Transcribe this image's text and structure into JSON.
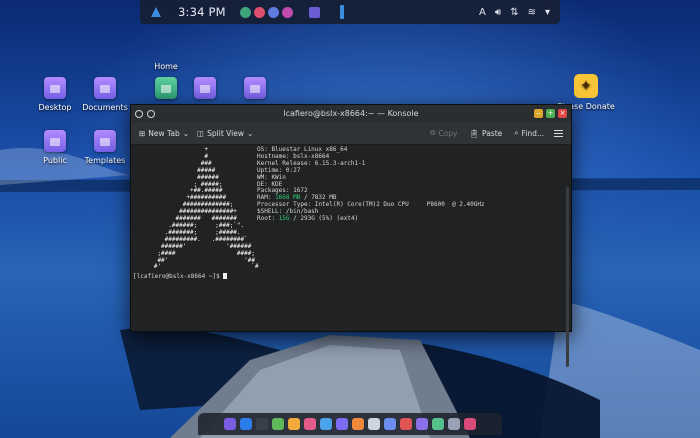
{
  "top_panel": {
    "clock": "3:34 PM",
    "app_icon_colors": [
      "#3fa37c",
      "#e0506e",
      "#5e7be0",
      "#c04cb0"
    ],
    "tray_icons": [
      "accessibility-icon",
      "volume-icon",
      "network-icon",
      "wifi-icon",
      "chevron-down-icon"
    ]
  },
  "desktop": {
    "icons": [
      {
        "label": "Desktop"
      },
      {
        "label": "Documents"
      },
      {
        "label": "Home"
      },
      {
        "label": "Public"
      },
      {
        "label": "Templates"
      },
      {
        "label": "Please Donate"
      }
    ]
  },
  "konsole": {
    "title": "lcafiero@bslx-x8664:~ — Konsole",
    "toolbar": {
      "new_tab": "New Tab",
      "split_view": "Split View",
      "copy": "Copy",
      "paste": "Paste",
      "find": "Find..."
    },
    "info": {
      "os": "OS: Bluestar Linux x86_64",
      "hostname": "Hostname: bslx-x8664",
      "kernel": "Kernel Release: 6.15.3-arch1-1",
      "uptime": "Uptime: 0:27",
      "wm": "WM: KWin",
      "de": "DE: KDE",
      "packages": "Packages: 1672",
      "ram_label": "RAM: ",
      "ram_used": "1668 MB",
      "ram_total": " / 7832 MB",
      "processor": "Processor Type: Intel(R) Core(TM)2 Duo CPU     P8600  @ 2.40GHz",
      "shell": "$SHELL: /bin/bash",
      "root_label": "Root: ",
      "root_used": "15G",
      "root_total": " / 293G (5%) (ext4)"
    },
    "prompt": "[lcafiero@bslx-x8664 ~]$ "
  },
  "dock": {
    "icon_colors": [
      "#7a5ce0",
      "#2b7de9",
      "#3a3f4a",
      "#5fb85c",
      "#f2a93b",
      "#e45a8a",
      "#4aa3e8",
      "#7d6cf2",
      "#f08a3c",
      "#d0d4dc",
      "#6a8ff0",
      "#e25555",
      "#8a6fe8",
      "#57c28a",
      "#9aa3b5",
      "#d94c7a"
    ]
  }
}
